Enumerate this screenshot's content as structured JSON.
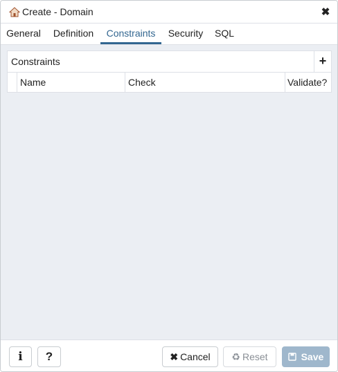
{
  "dialog": {
    "title": "Create - Domain",
    "icon": "home-icon",
    "close_icon": "close-icon"
  },
  "tabs": [
    {
      "label": "General",
      "active": false
    },
    {
      "label": "Definition",
      "active": false
    },
    {
      "label": "Constraints",
      "active": true
    },
    {
      "label": "Security",
      "active": false
    },
    {
      "label": "SQL",
      "active": false
    }
  ],
  "constraints": {
    "title": "Constraints",
    "add_icon": "plus-icon",
    "columns": [
      "Name",
      "Check",
      "Validate?"
    ],
    "rows": []
  },
  "footer": {
    "info_icon": "info-icon",
    "help_icon": "question-icon",
    "cancel_label": "Cancel",
    "reset_label": "Reset",
    "save_label": "Save"
  },
  "colors": {
    "accent": "#326690",
    "content_bg": "#ebeef3",
    "save_disabled": "#9fb7cc"
  }
}
